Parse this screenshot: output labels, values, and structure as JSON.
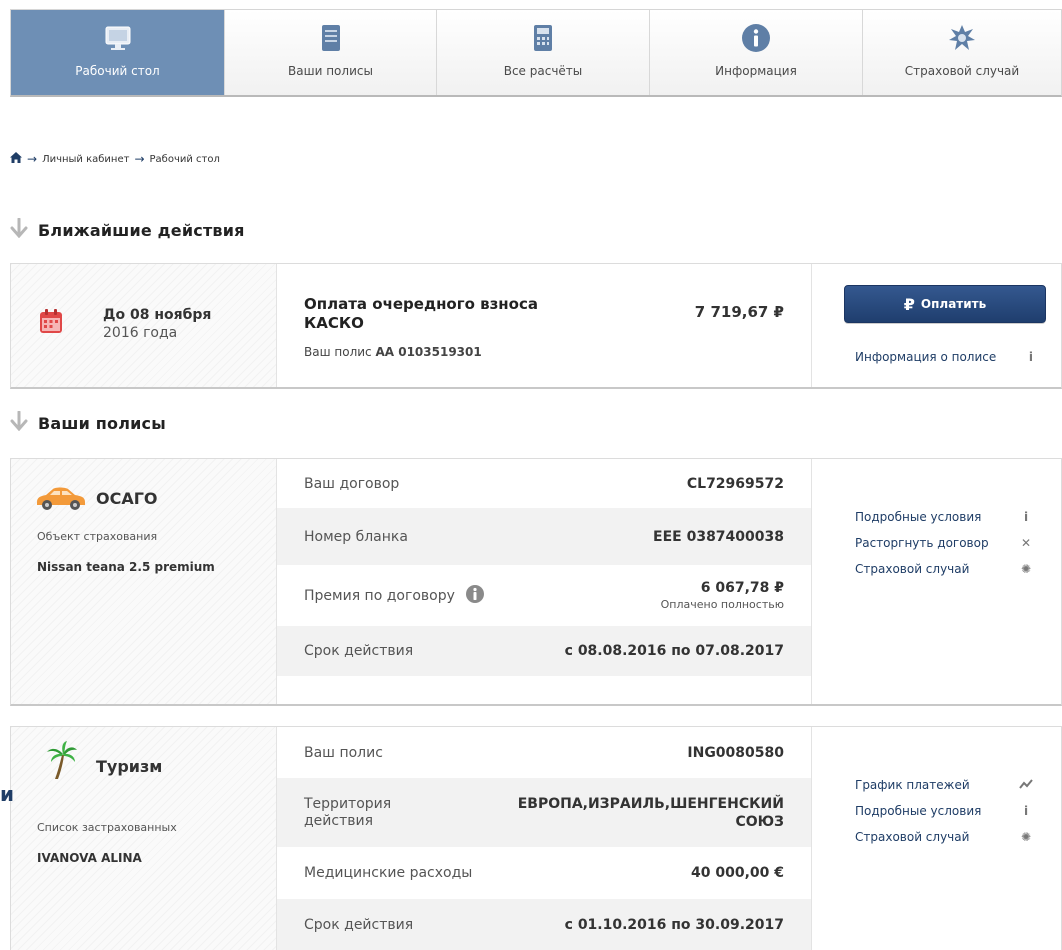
{
  "nav": {
    "tabs": [
      {
        "label": "Рабочий стол",
        "icon": "desktop-icon",
        "active": true
      },
      {
        "label": "Ваши полисы",
        "icon": "document-icon",
        "active": false
      },
      {
        "label": "Все расчёты",
        "icon": "calculator-icon",
        "active": false
      },
      {
        "label": "Информация",
        "icon": "info-icon",
        "active": false
      },
      {
        "label": "Страховой случай",
        "icon": "accident-icon",
        "active": false
      }
    ]
  },
  "breadcrumb": {
    "home_icon": "home-icon",
    "items": [
      "Личный кабинет",
      "Рабочий стол"
    ],
    "separator": "→"
  },
  "sections": {
    "next_actions_title": "Ближайшие действия",
    "policies_title": "Ваши полисы"
  },
  "next_action": {
    "date_line1": "До 08 ноября",
    "date_line2": "2016 года",
    "title": "Оплата очередного взноса КАСКО",
    "policy_prefix": "Ваш полис",
    "policy_number": "АА 0103519301",
    "amount": "7 719,67 ₽",
    "pay_button": "Оплатить",
    "pay_button_symbol": "₽",
    "policy_info_link": "Информация о полисе"
  },
  "osago": {
    "name": "ОСАГО",
    "object_label": "Объект страхования",
    "object_value": "Nissan teana 2.5 premium",
    "rows": [
      {
        "key": "Ваш договор",
        "value": "CL72969572"
      },
      {
        "key": "Номер бланка",
        "value": "ЕЕЕ 0387400038"
      },
      {
        "key": "Премия по договору",
        "value": "6 067,78 ₽",
        "note": "Оплачено полностью"
      },
      {
        "key": "Срок действия",
        "value": "с 08.08.2016 по 07.08.2017"
      }
    ],
    "links": [
      {
        "label": "Подробные условия",
        "icon": "info-icon",
        "glyph": "i"
      },
      {
        "label": "Расторгнуть договор",
        "icon": "close-icon",
        "glyph": "✕"
      },
      {
        "label": "Страховой случай",
        "icon": "accident-icon",
        "glyph": "✺"
      }
    ]
  },
  "tourism": {
    "name": "Туризм",
    "insured_label": "Список застрахованных",
    "insured_value": "IVANOVA ALINA",
    "rows": [
      {
        "key": "Ваш полис",
        "value": "ING0080580"
      },
      {
        "key": "Территория действия",
        "value": "ЕВРОПА,ИЗРАИЛЬ,ШЕНГЕНСКИЙ СОЮЗ"
      },
      {
        "key": "Медицинские расходы",
        "value": "40 000,00 €"
      },
      {
        "key": "Срок действия",
        "value": "с 01.10.2016 по 30.09.2017"
      }
    ],
    "links": [
      {
        "label": "График платежей",
        "icon": "chart-icon",
        "glyph": "〰"
      },
      {
        "label": "Подробные условия",
        "icon": "info-icon",
        "glyph": "i"
      },
      {
        "label": "Страховой случай",
        "icon": "accident-icon",
        "glyph": "✺"
      }
    ]
  },
  "stray_text": "и",
  "colors": {
    "active_tab": "#6e8fb5",
    "button": "#25457a",
    "link": "#1f3d66",
    "calendar": "#e04848",
    "car": "#f39a3a",
    "palm": "#2f9a35"
  }
}
